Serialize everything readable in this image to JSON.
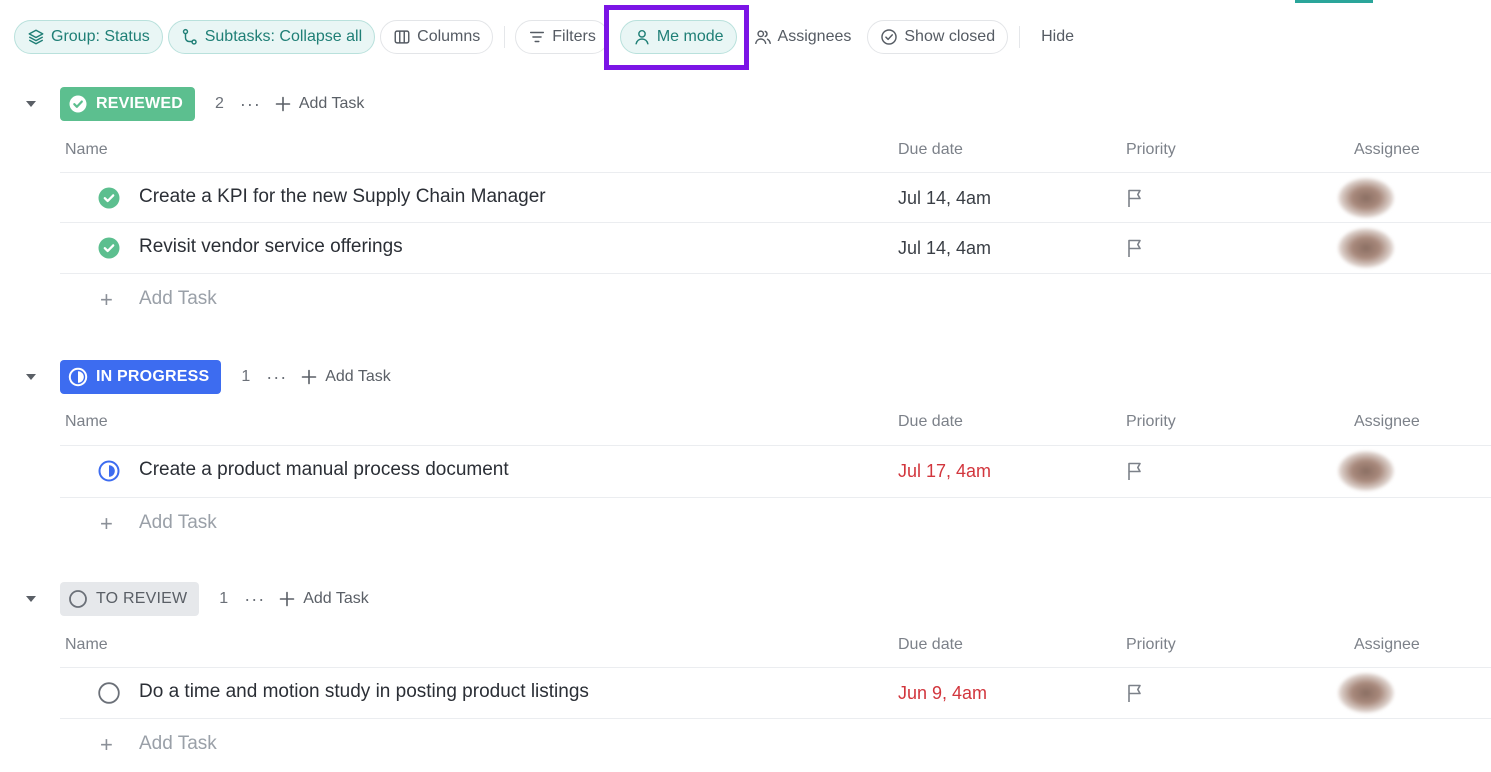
{
  "toolbar": {
    "group": "Group: Status",
    "subtasks": "Subtasks: Collapse all",
    "columns": "Columns",
    "filters": "Filters",
    "me_mode": "Me mode",
    "assignees": "Assignees",
    "show_closed": "Show closed",
    "hide": "Hide"
  },
  "columns": {
    "name": "Name",
    "due": "Due date",
    "priority": "Priority",
    "assignee": "Assignee"
  },
  "add_task": "Add Task",
  "groups": [
    {
      "status": "REVIEWED",
      "count": "2",
      "tasks": [
        {
          "name": "Create a KPI for the new Supply Chain Manager",
          "due": "Jul 14, 4am"
        },
        {
          "name": "Revisit vendor service offerings",
          "due": "Jul 14, 4am"
        }
      ]
    },
    {
      "status": "IN PROGRESS",
      "count": "1",
      "tasks": [
        {
          "name": "Create a product manual process document",
          "due": "Jul 17, 4am"
        }
      ]
    },
    {
      "status": "TO REVIEW",
      "count": "1",
      "tasks": [
        {
          "name": "Do a time and motion study in posting product listings",
          "due": "Jun 9, 4am"
        }
      ]
    }
  ],
  "colors": {
    "reviewed": "#5cbf8f",
    "in_progress": "#3d6cf0",
    "to_review": "#e6e8eb",
    "overdue": "#d2363d",
    "highlight": "#7b14e6",
    "active_pill": "#1f7f76"
  },
  "icons": {
    "group": "layers-icon",
    "subtasks": "subtasks-icon",
    "columns": "columns-icon",
    "filters": "filter-icon",
    "me_mode": "user-icon",
    "assignees": "users-icon",
    "show_closed": "check-circle-icon",
    "reviewed": "check-circle-icon",
    "in_progress": "half-circle-icon",
    "to_review": "empty-circle-icon",
    "priority": "flag-icon"
  }
}
